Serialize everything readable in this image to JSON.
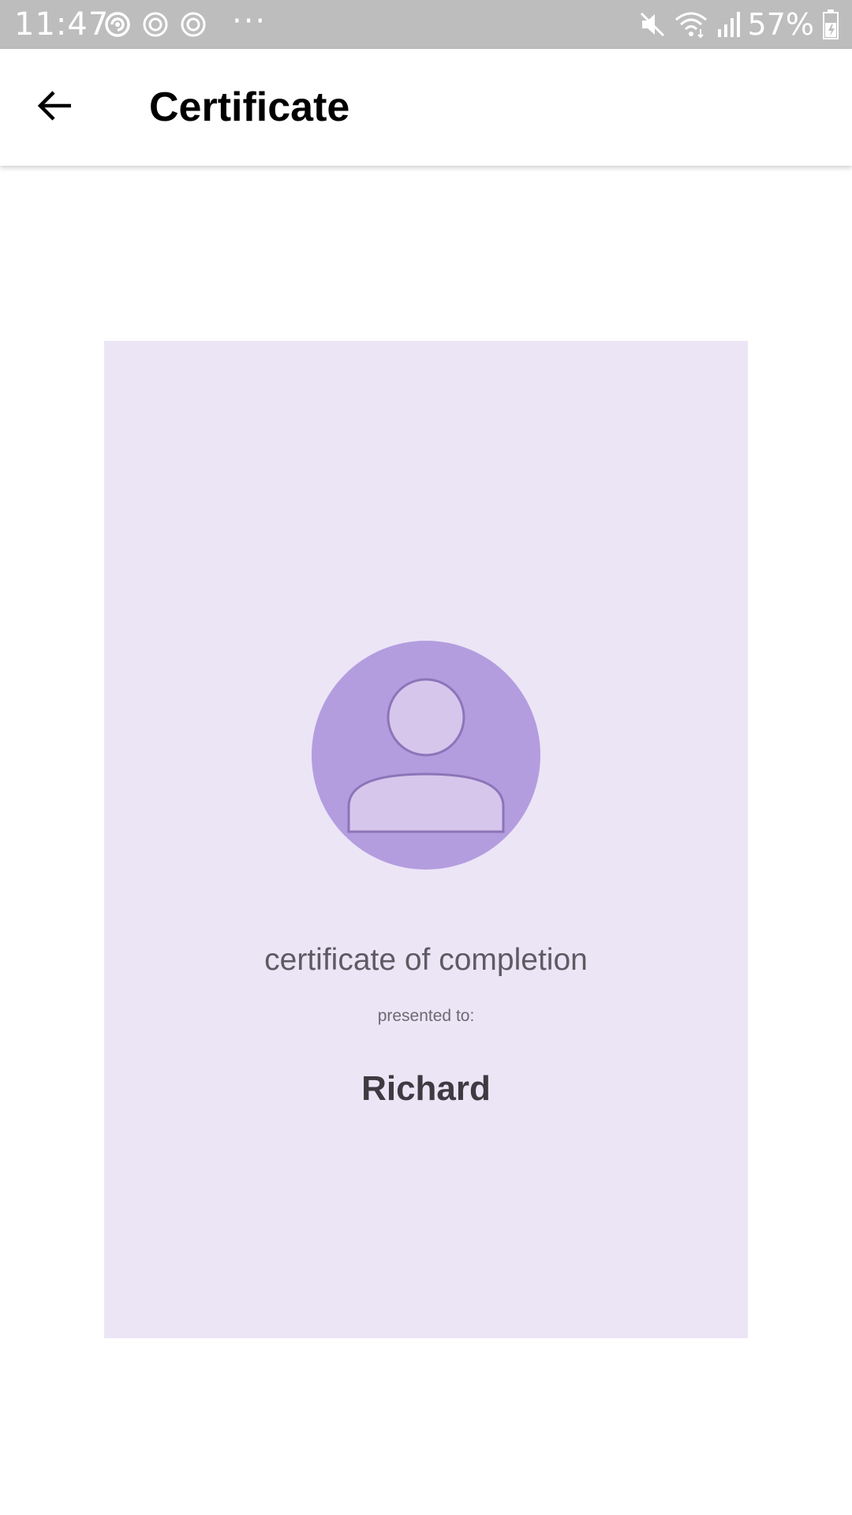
{
  "status_bar": {
    "time": "11:47",
    "notification_icons": [
      "sync-icon",
      "target-icon",
      "target-icon"
    ],
    "more_indicator": "···",
    "battery_percent": "57%",
    "right_icons": [
      "mute-icon",
      "wifi-icon",
      "signal-icon",
      "battery-icon"
    ]
  },
  "app_bar": {
    "title": "Certificate",
    "back_icon": "arrow-left-icon"
  },
  "certificate": {
    "background_color": "#ece5f6",
    "avatar_color": "#b39ddf",
    "avatar_icon": "person-icon",
    "heading": "certificate of completion",
    "presented_label": "presented to:",
    "recipient_name": "Richard"
  }
}
